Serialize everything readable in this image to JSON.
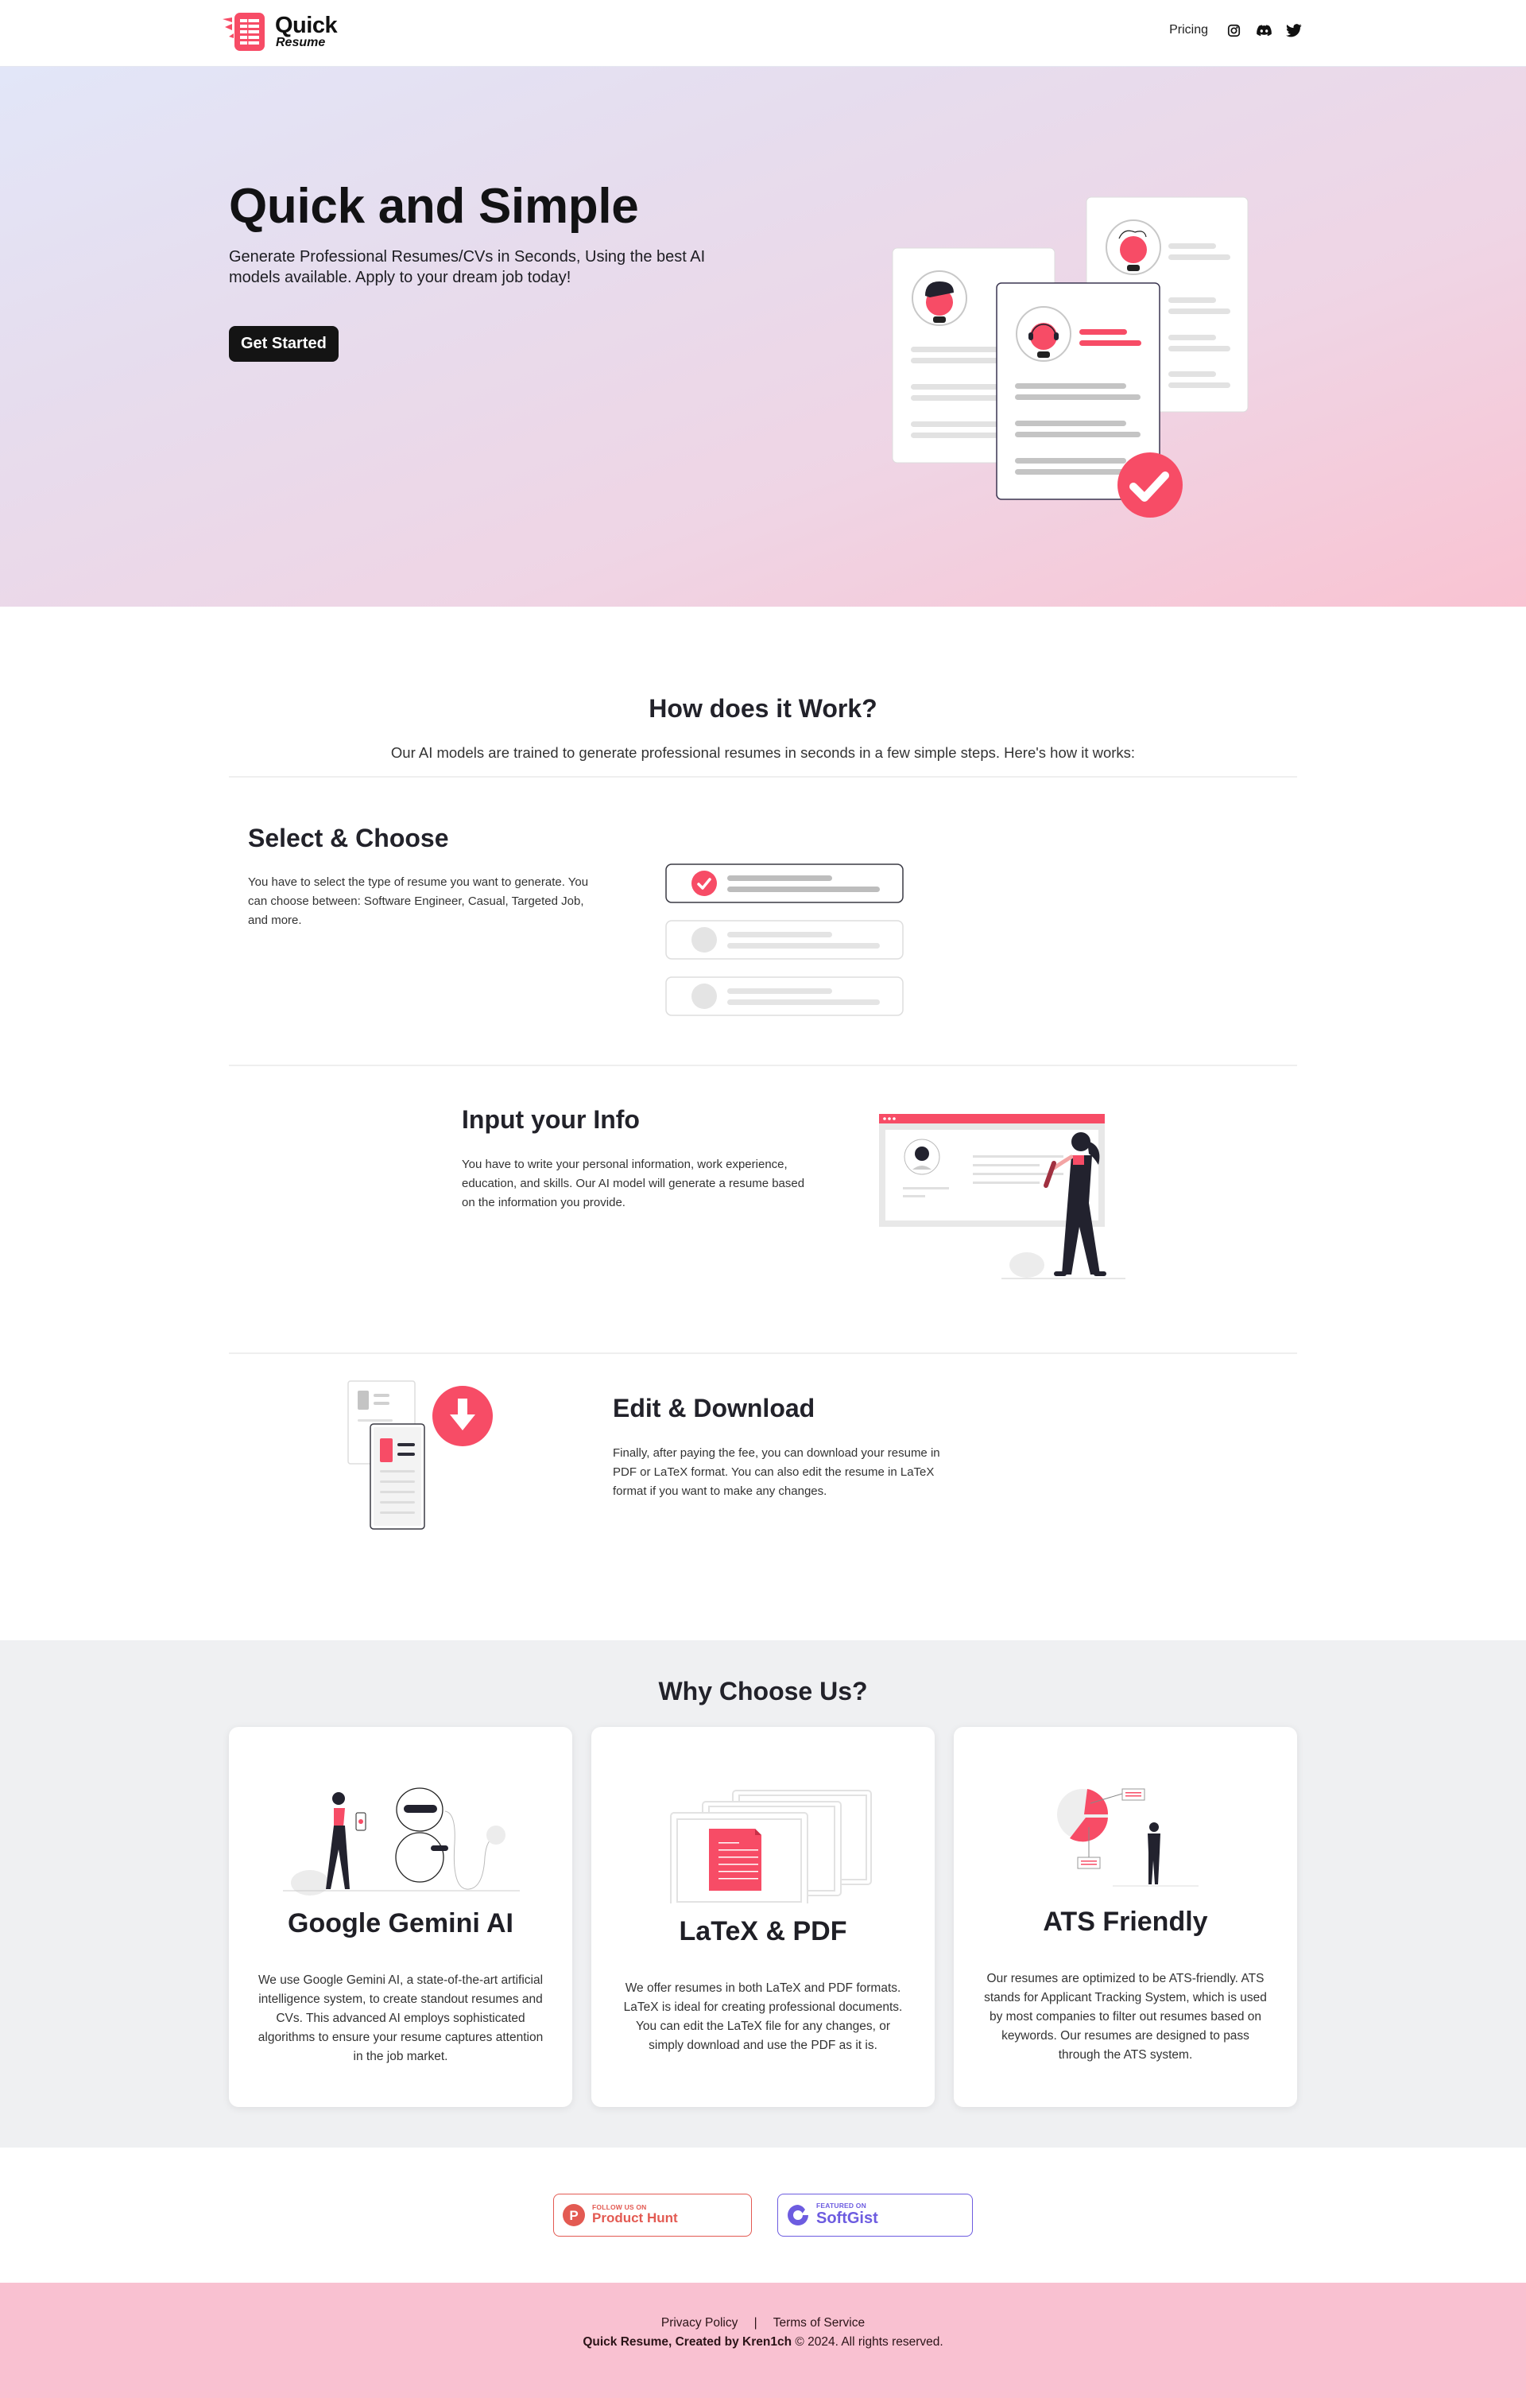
{
  "header": {
    "logo": {
      "quick": "Quick",
      "resume": "Resume"
    },
    "nav": {
      "pricing": "Pricing",
      "icons": [
        "instagram-icon",
        "discord-icon",
        "twitter-icon"
      ]
    }
  },
  "hero": {
    "title": "Quick and Simple",
    "subtitle": "Generate Professional Resumes/CVs in Seconds, Using the best AI models available. Apply to your dream job today!",
    "cta": "Get Started"
  },
  "how": {
    "title": "How does it Work?",
    "subtitle": "Our AI models are trained to generate professional resumes in seconds in a few simple steps. Here's how it works:",
    "steps": [
      {
        "title": "Select & Choose",
        "text": "You have to select the type of resume you want to generate. You can choose between: Software Engineer, Casual, Targeted Job, and more."
      },
      {
        "title": "Input your Info",
        "text": "You have to write your personal information, work experience, education, and skills. Our AI model will generate a resume based on the information you provide."
      },
      {
        "title": "Edit & Download",
        "text": "Finally, after paying the fee, you can download your resume in PDF or LaTeX format. You can also edit the resume in LaTeX format if you want to make any changes."
      }
    ]
  },
  "why": {
    "title": "Why Choose Us?",
    "cards": [
      {
        "title": "Google Gemini AI",
        "text": "We use Google Gemini AI, a state-of-the-art artificial intelligence system, to create standout resumes and CVs. This advanced AI employs sophisticated algorithms to ensure your resume captures attention in the job market."
      },
      {
        "title": "LaTeX & PDF",
        "text": "We offer resumes in both LaTeX and PDF formats. LaTeX is ideal for creating professional documents. You can edit the LaTeX file for any changes, or simply download and use the PDF as it is."
      },
      {
        "title": "ATS Friendly",
        "text": "Our resumes are optimized to be ATS-friendly. ATS stands for Applicant Tracking System, which is used by most companies to filter out resumes based on keywords. Our resumes are designed to pass through the ATS system."
      }
    ]
  },
  "badges": {
    "product_hunt": {
      "small": "FOLLOW US ON",
      "big": "Product Hunt",
      "letter": "P"
    },
    "softgist": {
      "small": "FEATURED ON",
      "big": "SoftGist"
    }
  },
  "footer": {
    "privacy": "Privacy Policy",
    "separator": "|",
    "terms": "Terms of Service",
    "copy_bold": "Quick Resume, Created by Kren1ch",
    "copy_rest": " © 2024. All rights reserved."
  },
  "colors": {
    "accent": "#f74c66",
    "dark": "#141414",
    "product_hunt": "#e35a52",
    "softgist": "#6d5ce0",
    "footer_bg": "#f9c1d1",
    "why_bg": "#eff0f2"
  }
}
